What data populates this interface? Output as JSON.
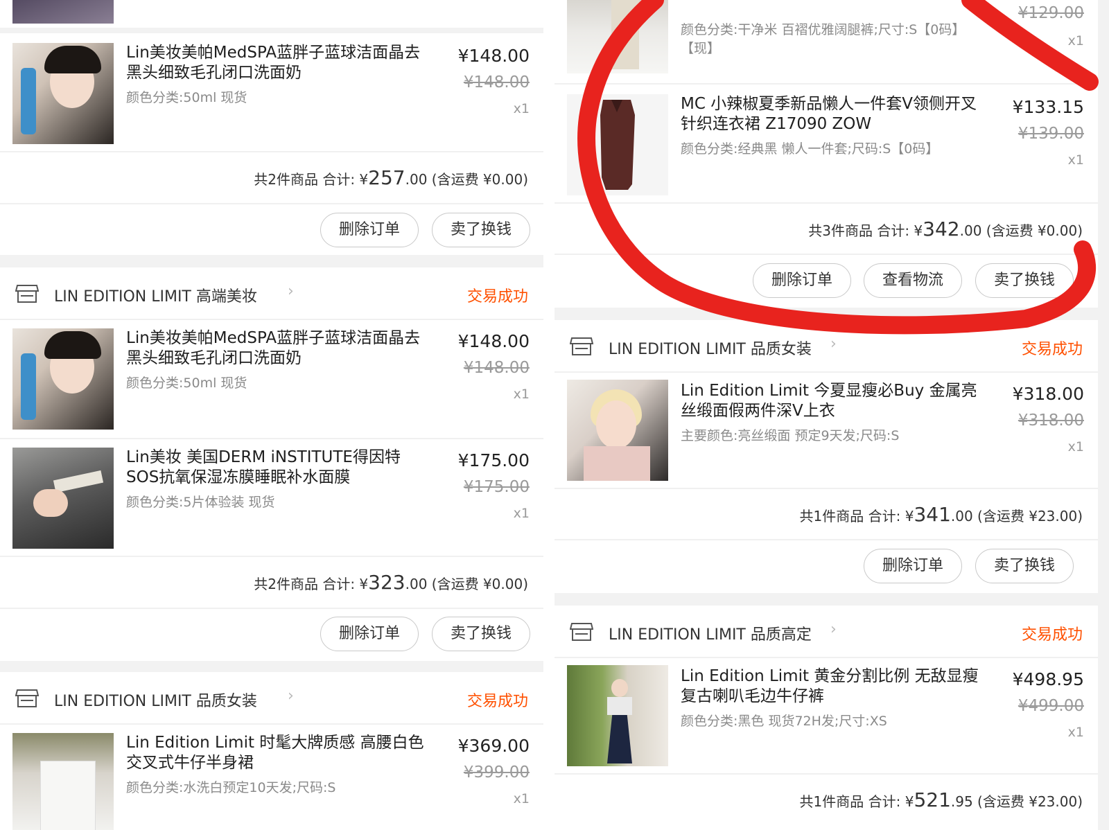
{
  "left": {
    "o1": {
      "item": {
        "title": "Lin美妆美帕MedSPA蓝胖子蓝球洁面晶去黑头细致毛孔闭口洗面奶",
        "sku": "颜色分类:50ml 现货",
        "price": "¥148.00",
        "orig": "¥148.00",
        "qty": "x1"
      },
      "summary": {
        "pre": "共2件商品 合计: ¥",
        "big": "257",
        "post": ".00 (含运费 ¥0.00)"
      },
      "btn_delete": "删除订单",
      "btn_sell": "卖了换钱"
    },
    "o2": {
      "shop": "LIN EDITION LIMIT 高端美妆",
      "status": "交易成功",
      "item1": {
        "title": "Lin美妆美帕MedSPA蓝胖子蓝球洁面晶去黑头细致毛孔闭口洗面奶",
        "sku": "颜色分类:50ml 现货",
        "price": "¥148.00",
        "orig": "¥148.00",
        "qty": "x1"
      },
      "item2": {
        "title": "Lin美妆 美国DERM iNSTITUTE得因特SOS抗氧保湿冻膜睡眠补水面膜",
        "sku": "颜色分类:5片体验装 现货",
        "price": "¥175.00",
        "orig": "¥175.00",
        "qty": "x1"
      },
      "summary": {
        "pre": "共2件商品 合计: ¥",
        "big": "323",
        "post": ".00 (含运费 ¥0.00)"
      },
      "btn_delete": "删除订单",
      "btn_sell": "卖了换钱"
    },
    "o3": {
      "shop": "LIN EDITION LIMIT 品质女装",
      "status": "交易成功",
      "item": {
        "title": "Lin Edition Limit 时髦大牌质感 高腰白色交叉式牛仔半身裙",
        "sku": "颜色分类:水洗白预定10天发;尺码:S",
        "price": "¥369.00",
        "orig": "¥399.00",
        "qty": "x1"
      }
    }
  },
  "right": {
    "o1": {
      "item0": {
        "sku": "颜色分类:干净米 百褶优雅阔腿裤;尺寸:S【0码】【现】",
        "orig": "¥129.00",
        "qty": "x1"
      },
      "item": {
        "title": "MC 小辣椒夏季新品懒人一件套V领侧开叉针织连衣裙 Z17090 ZOW",
        "sku": "颜色分类:经典黑 懒人一件套;尺码:S【0码】",
        "price": "¥133.15",
        "orig": "¥139.00",
        "qty": "x1"
      },
      "summary": {
        "pre": "共3件商品 合计: ¥",
        "big": "342",
        "post": ".00 (含运费 ¥0.00)"
      },
      "btn_delete": "删除订单",
      "btn_logistics": "查看物流",
      "btn_sell": "卖了换钱"
    },
    "o2": {
      "shop": "LIN EDITION LIMIT 品质女装",
      "status": "交易成功",
      "item": {
        "title": "Lin Edition Limit 今夏显瘦必Buy 金属亮丝缎面假两件深V上衣",
        "sku": "主要颜色:亮丝缎面 预定9天发;尺码:S",
        "price": "¥318.00",
        "orig": "¥318.00",
        "qty": "x1"
      },
      "summary": {
        "pre": "共1件商品 合计: ¥",
        "big": "341",
        "post": ".00 (含运费 ¥23.00)"
      },
      "btn_delete": "删除订单",
      "btn_sell": "卖了换钱"
    },
    "o3": {
      "shop": "LIN EDITION LIMIT 品质高定",
      "status": "交易成功",
      "item": {
        "title": "Lin Edition Limit 黄金分割比例 无敌显瘦 复古喇叭毛边牛仔裤",
        "sku": "颜色分类:黑色 现货72H发;尺寸:XS",
        "price": "¥498.95",
        "orig": "¥499.00",
        "qty": "x1"
      },
      "summary": {
        "pre": "共1件商品 合计: ¥",
        "big": "521",
        "post": ".95 (含运费 ¥23.00)"
      }
    }
  },
  "chevron": "›",
  "colors": {
    "status": "#ff5000",
    "annotation": "#e8231e"
  }
}
